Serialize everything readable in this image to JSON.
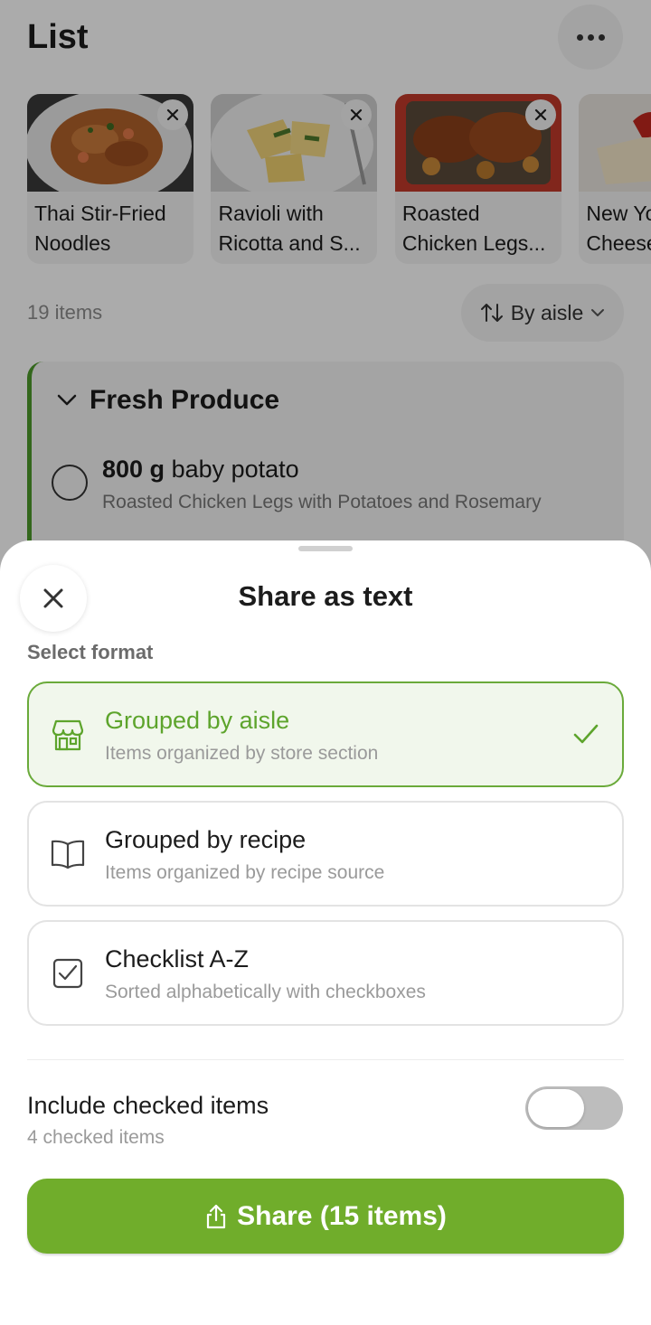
{
  "header": {
    "title": "List"
  },
  "recipes": [
    {
      "name": "Thai Stir-Fried Noodles"
    },
    {
      "name": "Ravioli with Ricotta and S..."
    },
    {
      "name": "Roasted Chicken Legs..."
    },
    {
      "name": "New York Cheesecake"
    }
  ],
  "list": {
    "count_label": "19 items",
    "sort_label": "By aisle"
  },
  "section": {
    "title": "Fresh Produce",
    "item": {
      "quantity": "800 g",
      "name": "baby potato",
      "source": "Roasted Chicken Legs with Potatoes and Rosemary"
    }
  },
  "sheet": {
    "title": "Share as text",
    "format_label": "Select format",
    "options": [
      {
        "title": "Grouped by aisle",
        "subtitle": "Items organized by store section",
        "icon": "store-icon",
        "selected": true
      },
      {
        "title": "Grouped by recipe",
        "subtitle": "Items organized by recipe source",
        "icon": "book-icon",
        "selected": false
      },
      {
        "title": "Checklist A-Z",
        "subtitle": "Sorted alphabetically with checkboxes",
        "icon": "checkbox-icon",
        "selected": false
      }
    ],
    "include_checked": {
      "label": "Include checked items",
      "sublabel": "4 checked items",
      "enabled": false
    },
    "share_button": "Share (15 items)"
  },
  "colors": {
    "accent": "#70ad2b",
    "accent_text": "#5da42c",
    "selected_bg": "#f1f7ec",
    "section_bar": "#4d9a2a"
  }
}
